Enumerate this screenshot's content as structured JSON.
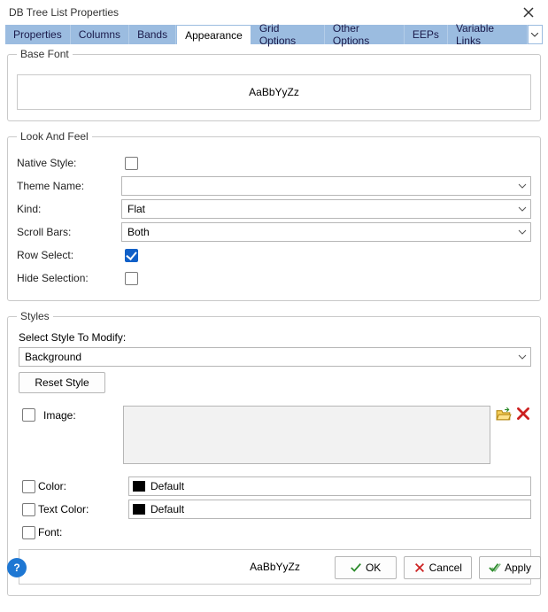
{
  "window": {
    "title": "DB Tree List Properties"
  },
  "tabs": {
    "items": [
      "Properties",
      "Columns",
      "Bands",
      "Appearance",
      "Grid Options",
      "Other Options",
      "EEPs",
      "Variable Links"
    ],
    "active_index": 3
  },
  "base_font": {
    "legend": "Base Font",
    "sample": "AaBbYyZz"
  },
  "look_and_feel": {
    "legend": "Look And Feel",
    "native_style": {
      "label": "Native Style:",
      "checked": false
    },
    "theme_name": {
      "label": "Theme Name:",
      "value": ""
    },
    "kind": {
      "label": "Kind:",
      "value": "Flat"
    },
    "scroll_bars": {
      "label": "Scroll Bars:",
      "value": "Both"
    },
    "row_select": {
      "label": "Row Select:",
      "checked": true
    },
    "hide_selection": {
      "label": "Hide Selection:",
      "checked": false
    }
  },
  "styles": {
    "legend": "Styles",
    "select_label": "Select Style To Modify:",
    "selected_style": "Background",
    "reset_label": "Reset Style",
    "image": {
      "label": "Image:",
      "checked": false
    },
    "color": {
      "label": "Color:",
      "checked": false,
      "value": "Default",
      "swatch": "#000000"
    },
    "text_color": {
      "label": "Text Color:",
      "checked": false,
      "value": "Default",
      "swatch": "#000000"
    },
    "font": {
      "label": "Font:",
      "checked": false
    },
    "sample": "AaBbYyZz"
  },
  "buttons": {
    "ok": "OK",
    "cancel": "Cancel",
    "apply": "Apply"
  }
}
